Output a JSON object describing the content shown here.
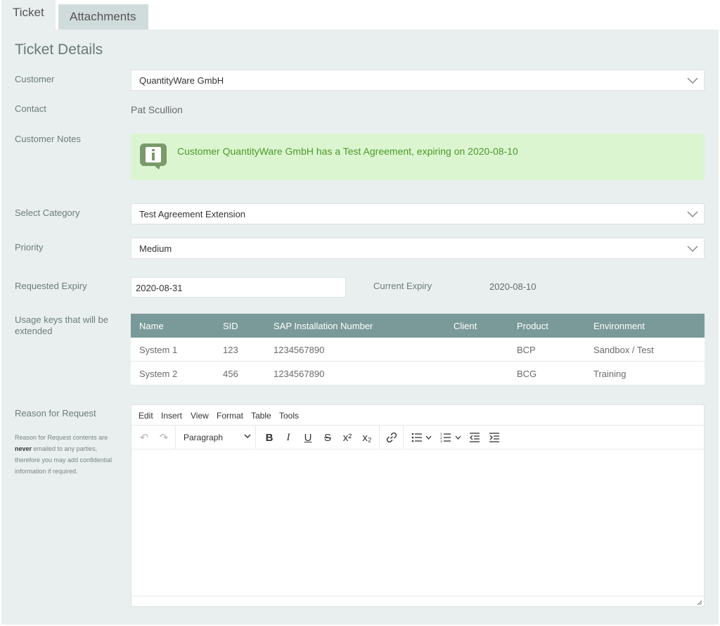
{
  "tabs": [
    {
      "label": "Ticket"
    },
    {
      "label": "Attachments"
    }
  ],
  "title": "Ticket Details",
  "customer": {
    "label": "Customer",
    "value": "QuantityWare GmbH"
  },
  "contact": {
    "label": "Contact",
    "value": "Pat Scullion"
  },
  "notes": {
    "label": "Customer Notes",
    "text": "Customer QuantityWare GmbH has a Test Agreement, expiring on 2020-08-10",
    "icon": "info-icon"
  },
  "category": {
    "label": "Select Category",
    "value": "Test Agreement Extension"
  },
  "priority": {
    "label": "Priority",
    "value": "Medium"
  },
  "requested_expiry": {
    "label": "Requested Expiry",
    "value": "2020-08-31"
  },
  "current_expiry": {
    "label": "Current Expiry",
    "value": "2020-08-10"
  },
  "usage_keys": {
    "label_line1": "Usage keys that will be",
    "label_line2": "extended",
    "columns": [
      "Name",
      "SID",
      "SAP Installation Number",
      "Client",
      "Product",
      "Environment"
    ],
    "rows": [
      [
        "System 1",
        "123",
        "1234567890",
        "",
        "BCP",
        "Sandbox / Test"
      ],
      [
        "System 2",
        "456",
        "1234567890",
        "",
        "BCG",
        "Training"
      ]
    ]
  },
  "reason": {
    "label": "Reason for Request",
    "help_line1": "Reason for Request contents are",
    "help_bold": "never",
    "help_line2_rest": " emailed to any parties,",
    "help_line3": "therefore you may add confidential",
    "help_line4": "information if required."
  },
  "editor": {
    "menu": [
      "Edit",
      "Insert",
      "View",
      "Format",
      "Table",
      "Tools"
    ],
    "block_format": "Paragraph",
    "toolbar_icons": [
      "undo-icon",
      "redo-icon",
      "bold-icon",
      "italic-icon",
      "underline-icon",
      "strikethrough-icon",
      "superscript-icon",
      "subscript-icon",
      "link-icon",
      "bullet-list-icon",
      "numbered-list-icon",
      "outdent-icon",
      "indent-icon"
    ],
    "content": ""
  },
  "colors": {
    "panel": "#e8efee",
    "table_header": "#7a9a99",
    "notice_bg": "#dcf5d1",
    "notice_text": "#4a9a27"
  }
}
